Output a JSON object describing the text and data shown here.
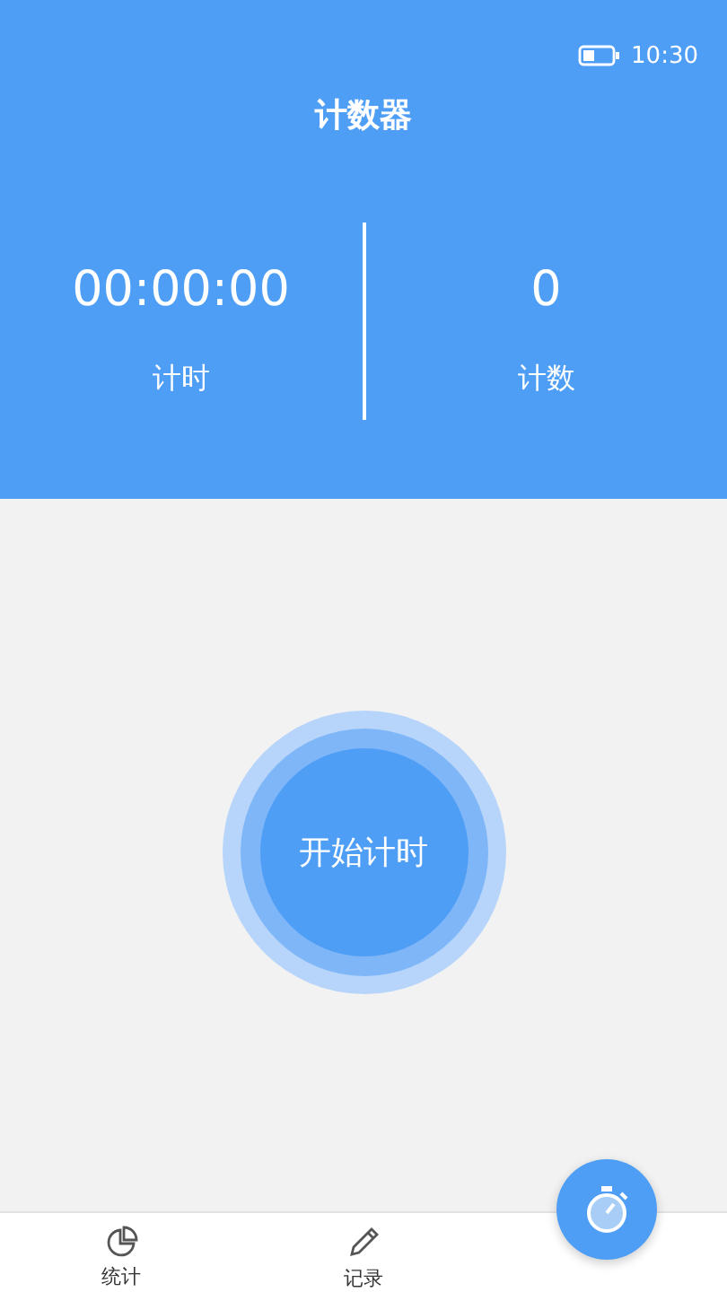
{
  "status_bar": {
    "time": "10:30"
  },
  "window": {
    "title": "计数器"
  },
  "stats": [
    {
      "value": "00:00:00",
      "label": "计时"
    },
    {
      "value": "0",
      "label": "计数"
    }
  ],
  "start_button": {
    "label": "开始计时"
  },
  "bottom_nav": [
    {
      "label": "统计",
      "kind": "pie"
    },
    {
      "label": "记录",
      "kind": "pencil"
    },
    {
      "kind": "stopwatch"
    }
  ]
}
